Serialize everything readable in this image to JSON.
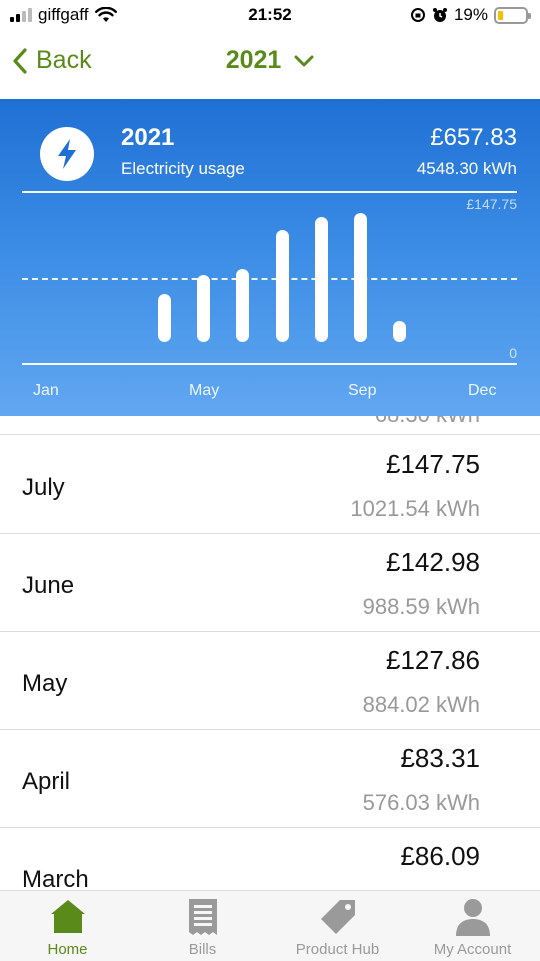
{
  "status": {
    "carrier": "giffgaff",
    "time": "21:52",
    "battery": "19%",
    "battery_level": 0.19
  },
  "nav": {
    "back_label": "Back",
    "year": "2021"
  },
  "summary": {
    "year": "2021",
    "subtitle": "Electricity usage",
    "cost": "£657.83",
    "kwh": "4548.30 kWh",
    "max_label": "£147.75",
    "zero_label": "0",
    "axis_labels": [
      "Jan",
      "May",
      "Sep",
      "Dec"
    ]
  },
  "chart_data": {
    "type": "bar",
    "categories": [
      "Jan",
      "Feb",
      "Mar",
      "Apr",
      "May",
      "Jun",
      "Jul",
      "Aug",
      "Sep",
      "Oct",
      "Nov",
      "Dec"
    ],
    "values": [
      null,
      null,
      55,
      77,
      83.31,
      127.86,
      142.98,
      147.75,
      24,
      null,
      null,
      null
    ],
    "ylim": [
      0,
      147.75
    ]
  },
  "list": {
    "clipped_text": "68.30 kWh",
    "rows": [
      {
        "month": "July",
        "cost": "£147.75",
        "kwh": "1021.54 kWh"
      },
      {
        "month": "June",
        "cost": "£142.98",
        "kwh": "988.59 kWh"
      },
      {
        "month": "May",
        "cost": "£127.86",
        "kwh": "884.02 kWh"
      },
      {
        "month": "April",
        "cost": "£83.31",
        "kwh": "576.03 kWh"
      },
      {
        "month": "March",
        "cost": "£86.09",
        "kwh": ""
      }
    ]
  },
  "tabs": [
    {
      "label": "Home",
      "icon": "home-icon",
      "active": true
    },
    {
      "label": "Bills",
      "icon": "bills-icon",
      "active": false
    },
    {
      "label": "Product Hub",
      "icon": "tag-icon",
      "active": false
    },
    {
      "label": "My Account",
      "icon": "person-icon",
      "active": false
    }
  ],
  "colors": {
    "accent": "#5a8a1a",
    "panel_top": "#1f70d4",
    "panel_bottom": "#62a7f1"
  }
}
